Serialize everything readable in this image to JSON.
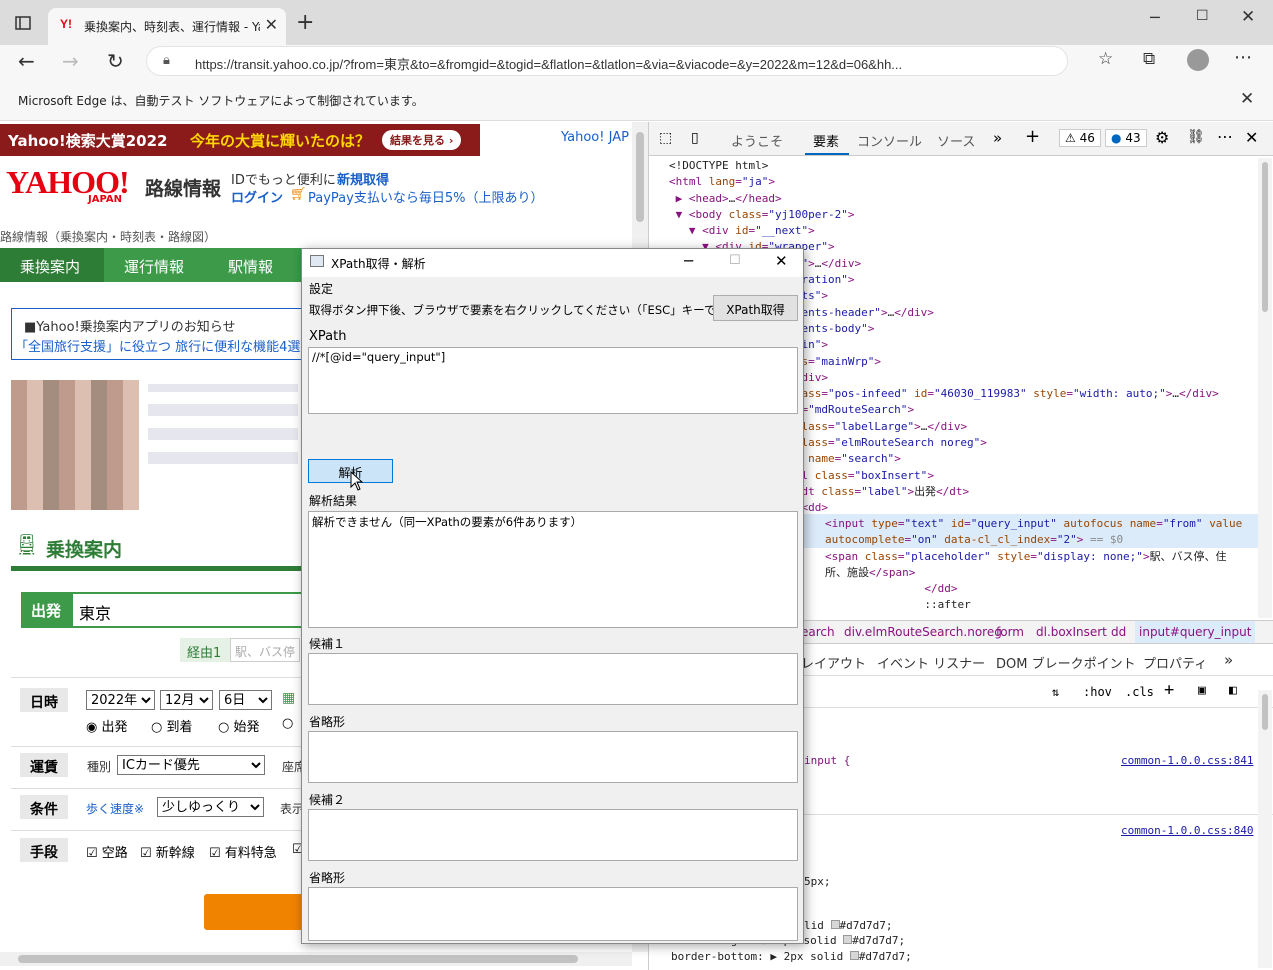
{
  "browser": {
    "tab_title": "乗換案内、時刻表、運行情報 - Ya",
    "tab_favicon": "Y!",
    "url": "https://transit.yahoo.co.jp/?from=東京&to=&fromgid=&togid=&flatlon=&tlatlon=&via=&viacode=&y=2022&m=12&d=06&hh...",
    "infobar": "Microsoft Edge は、自動テスト ソフトウェアによって制御されています。"
  },
  "page": {
    "banner_left": "Yahoo!検索大賞2022",
    "banner_mid": "今年の大賞に輝いたのは？",
    "banner_btn": "結果を見る ›",
    "yahoo_jap": "Yahoo! JAP",
    "logo": "YAHOO!",
    "logo_sub": "JAPAN",
    "logo_title": "路線情報",
    "login_text1": "IDでもっと便利に",
    "login_text2": "新規取得",
    "login_link": "ログイン",
    "paypay": "PayPay支払いなら毎日5%（上限あり）",
    "breadcrumb": "路線情報（乗換案内・時刻表・路線図）",
    "nav": [
      "乗換案内",
      "運行情報",
      "駅情報"
    ],
    "notice_title": "■Yahoo!乗換案内アプリのお知らせ",
    "notice_link": "「全国旅行支援」に役立つ 旅行に便利な機能4選",
    "section_title": "乗換案内",
    "depart_label": "出発",
    "depart_value": "東京",
    "via_label": "経由1",
    "via_placeholder": "駅、バス停",
    "date_label": "日時",
    "year": "2022年",
    "month": "12月",
    "day": "6日",
    "radios": [
      "出発",
      "到着",
      "始発"
    ],
    "fare_label": "運賃",
    "fare_kind": "種別",
    "fare_value": "ICカード優先",
    "fare_extra": "座席",
    "cond_label": "条件",
    "cond_speed": "歩く速度※",
    "cond_value": "少しゆっくり",
    "cond_extra": "表示",
    "means_label": "手段",
    "means": [
      "空路",
      "新幹線",
      "有料特急"
    ]
  },
  "devtools": {
    "tabs": [
      "ようこそ",
      "要素",
      "コンソール",
      "ソース"
    ],
    "warnings": "46",
    "messages": "43",
    "breadcrumbs": [
      "earch",
      "div.elmRouteSearch.noreg",
      "form",
      "dl.boxInsert",
      "dd",
      "input#query_input"
    ],
    "subtabs": [
      "レイアウト",
      "イベント リスナー",
      "DOM ブレークポイント",
      "プロパティ"
    ],
    "filter_hov": ":hov",
    "filter_cls": ".cls",
    "style_link1": "common-1.0.0.css:841",
    "style_link2": "common-1.0.0.css:840",
    "style_selector": "input {",
    "style_5px": "5px;",
    "style_l1": "lid ",
    "style_l1b": "#d7d7d7;",
    "style_l2": "border-right: ▶ 1px solid ",
    "style_l3": "border-bottom: ▶ 2px solid ",
    "style_l3b": "#d7d7d7;"
  },
  "dialog": {
    "title": "XPath取得・解析",
    "settings_label": "設定",
    "instruction": "取得ボタン押下後、ブラウザで要素を右クリックしてください（「ESC」キーでキャンセル）",
    "get_button": "XPath取得",
    "xpath_label": "XPath",
    "xpath_value": "//*[@id=\"query_input\"]",
    "analyze_button": "解析",
    "result_label": "解析結果",
    "result_value": "解析できません（同一XPathの要素が6件あります）",
    "cand1_label": "候補１",
    "abbr1_label": "省略形",
    "cand2_label": "候補２",
    "abbr2_label": "省略形"
  }
}
